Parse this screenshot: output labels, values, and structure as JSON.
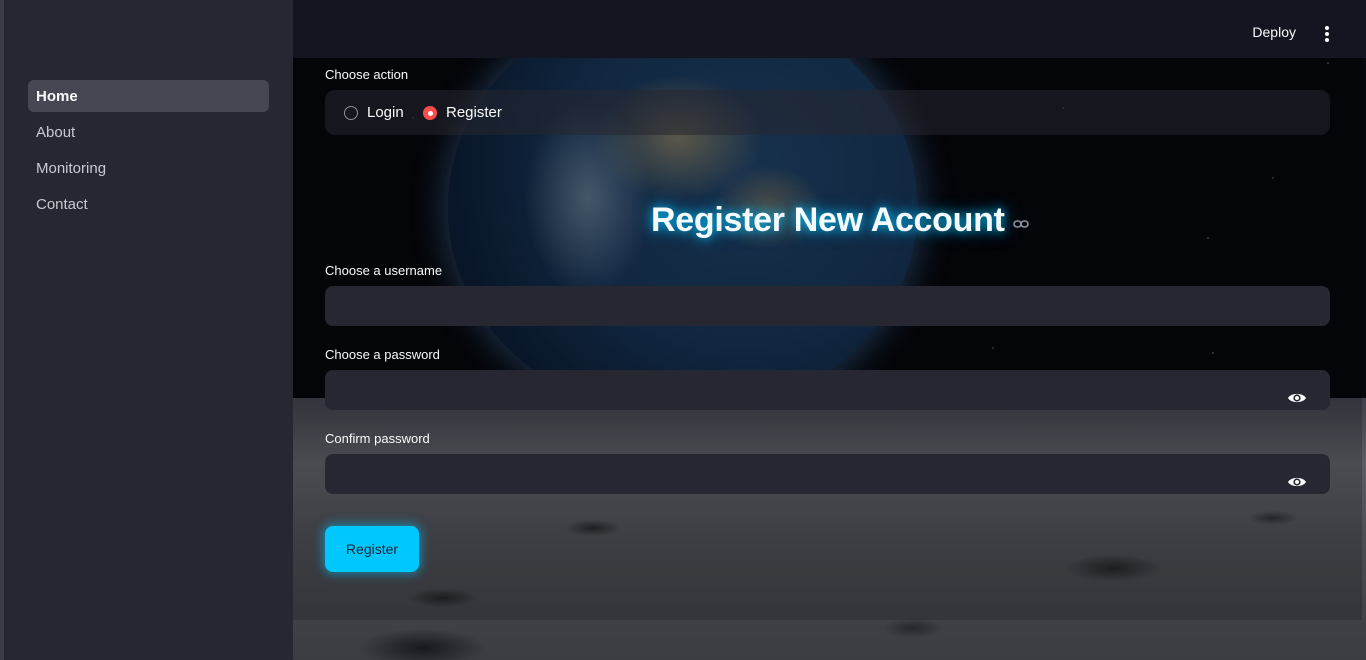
{
  "header": {
    "deploy_label": "Deploy",
    "menu_icon": "kebab-menu-icon"
  },
  "sidebar": {
    "items": [
      {
        "label": "Home",
        "active": true
      },
      {
        "label": "About",
        "active": false
      },
      {
        "label": "Monitoring",
        "active": false
      },
      {
        "label": "Contact",
        "active": false
      }
    ]
  },
  "form": {
    "action_label": "Choose action",
    "options": [
      {
        "label": "Login",
        "selected": false
      },
      {
        "label": "Register",
        "selected": true
      }
    ],
    "title": "Register New Account",
    "username_label": "Choose a username",
    "username_value": "",
    "password_label": "Choose a password",
    "password_value": "",
    "confirm_label": "Confirm password",
    "confirm_value": "",
    "submit_label": "Register"
  },
  "colors": {
    "accent": "#00c8ff",
    "radio_selected": "#ff4b4b",
    "sidebar_bg": "#262730",
    "header_bg": "#131520"
  }
}
